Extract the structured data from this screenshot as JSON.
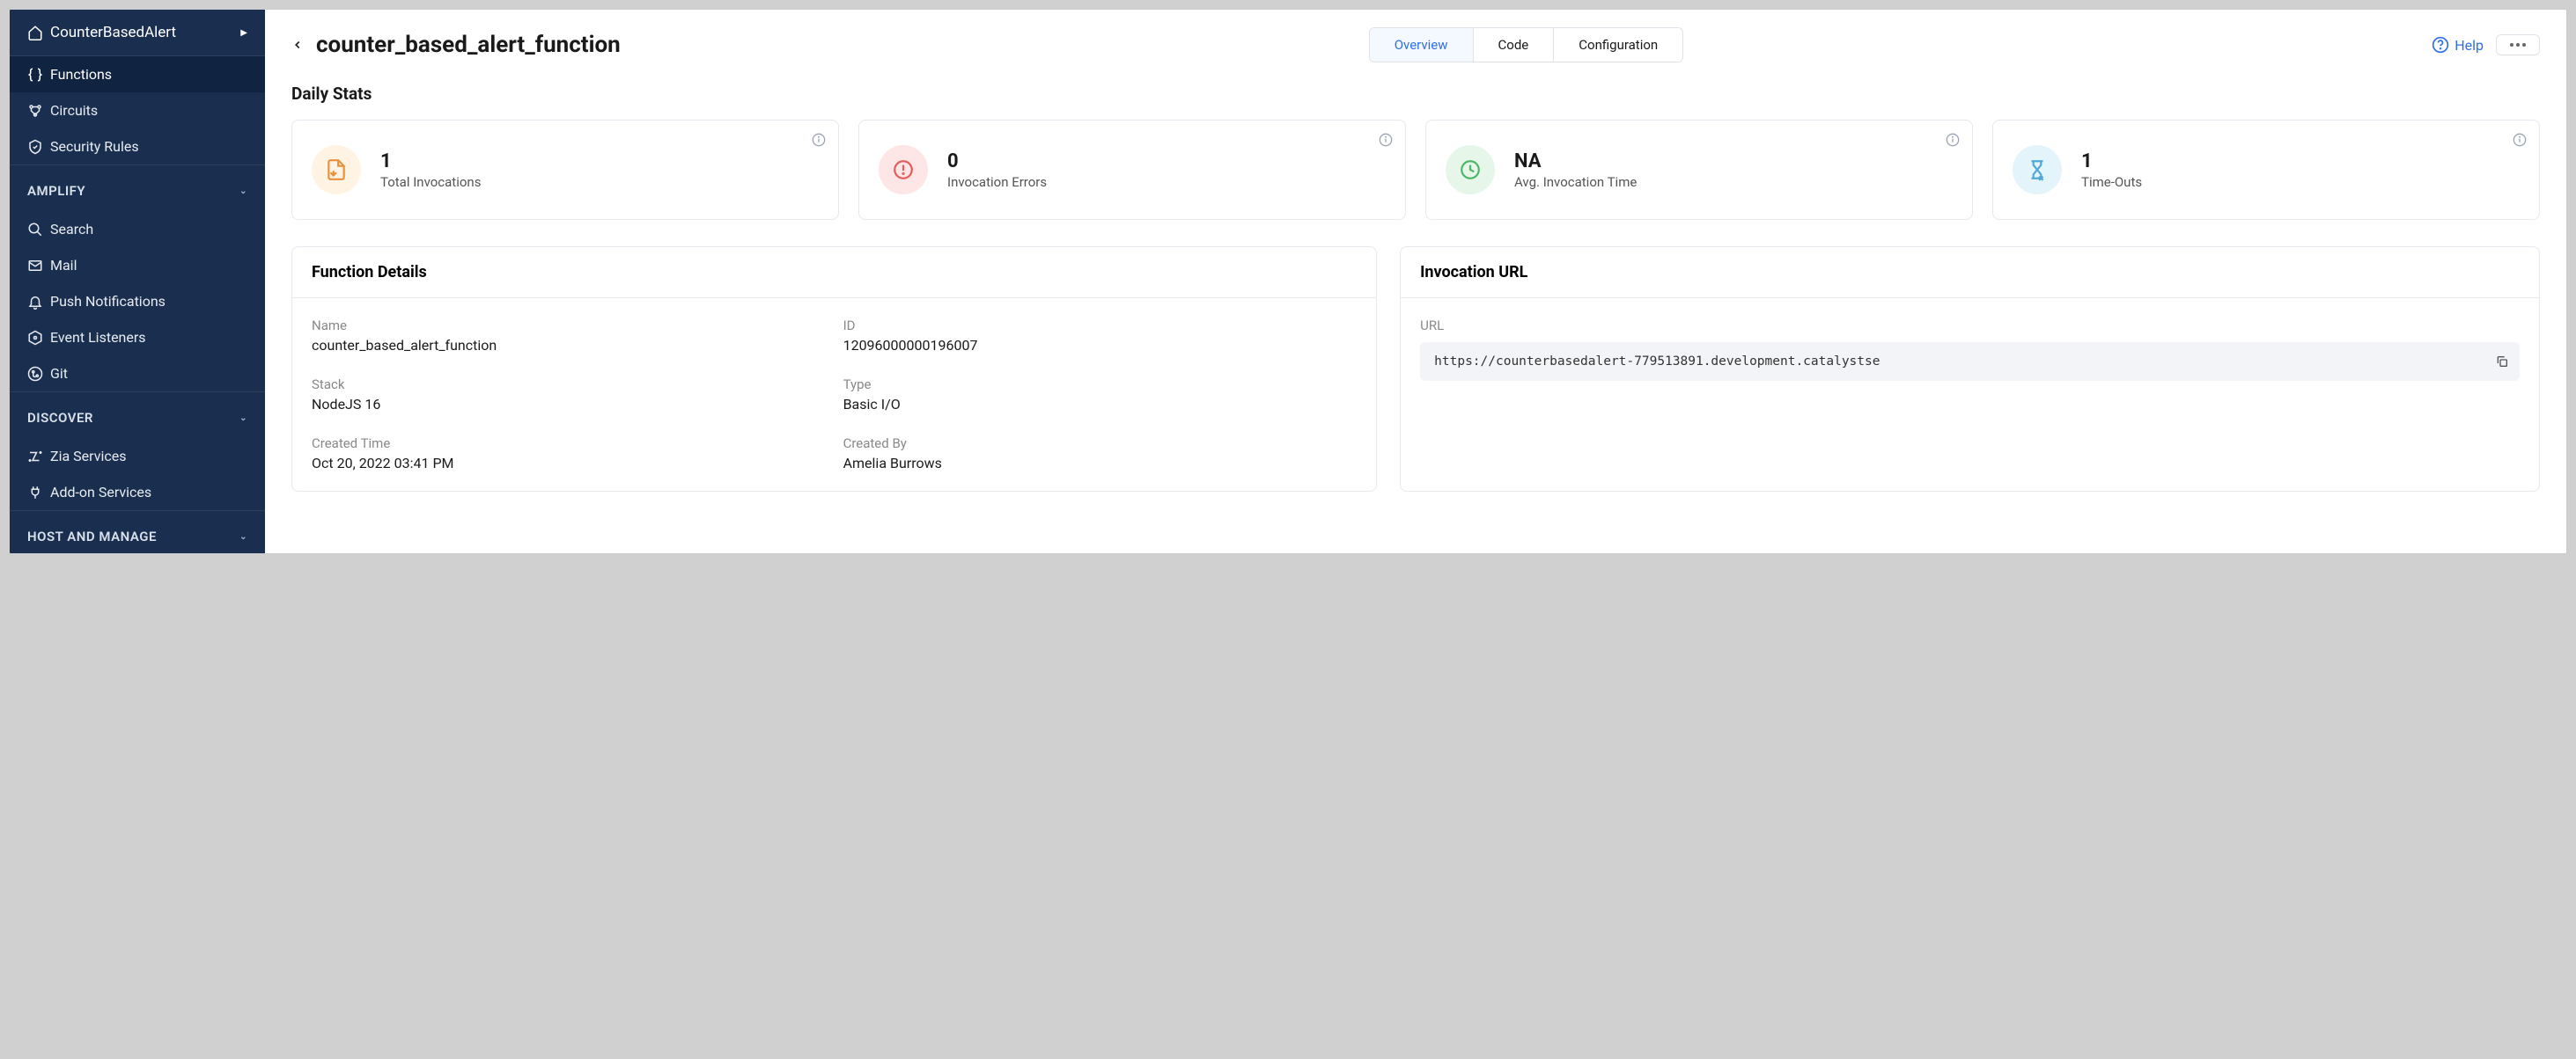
{
  "sidebar": {
    "project": "CounterBasedAlert",
    "items": [
      {
        "label": "Functions",
        "active": true
      },
      {
        "label": "Circuits",
        "active": false
      },
      {
        "label": "Security Rules",
        "active": false
      }
    ],
    "sections": [
      {
        "title": "AMPLIFY",
        "items": [
          "Search",
          "Mail",
          "Push Notifications",
          "Event Listeners",
          "Git"
        ]
      },
      {
        "title": "DISCOVER",
        "items": [
          "Zia Services",
          "Add-on Services"
        ]
      },
      {
        "title": "HOST AND MANAGE",
        "items": []
      }
    ]
  },
  "header": {
    "title": "counter_based_alert_function",
    "tabs": [
      {
        "label": "Overview",
        "active": true
      },
      {
        "label": "Code",
        "active": false
      },
      {
        "label": "Configuration",
        "active": false
      }
    ],
    "help": "Help"
  },
  "daily_stats": {
    "title": "Daily Stats",
    "cards": [
      {
        "value": "1",
        "label": "Total Invocations"
      },
      {
        "value": "0",
        "label": "Invocation Errors"
      },
      {
        "value": "NA",
        "label": "Avg. Invocation Time"
      },
      {
        "value": "1",
        "label": "Time-Outs"
      }
    ]
  },
  "function_details": {
    "title": "Function Details",
    "name_label": "Name",
    "name_value": "counter_based_alert_function",
    "id_label": "ID",
    "id_value": "12096000000196007",
    "stack_label": "Stack",
    "stack_value": "NodeJS 16",
    "type_label": "Type",
    "type_value": "Basic I/O",
    "created_time_label": "Created Time",
    "created_time_value": "Oct 20, 2022 03:41 PM",
    "created_by_label": "Created By",
    "created_by_value": "Amelia Burrows"
  },
  "invocation_url": {
    "title": "Invocation URL",
    "url_label": "URL",
    "url_value": "https://counterbasedalert-779513891.development.catalystse"
  }
}
